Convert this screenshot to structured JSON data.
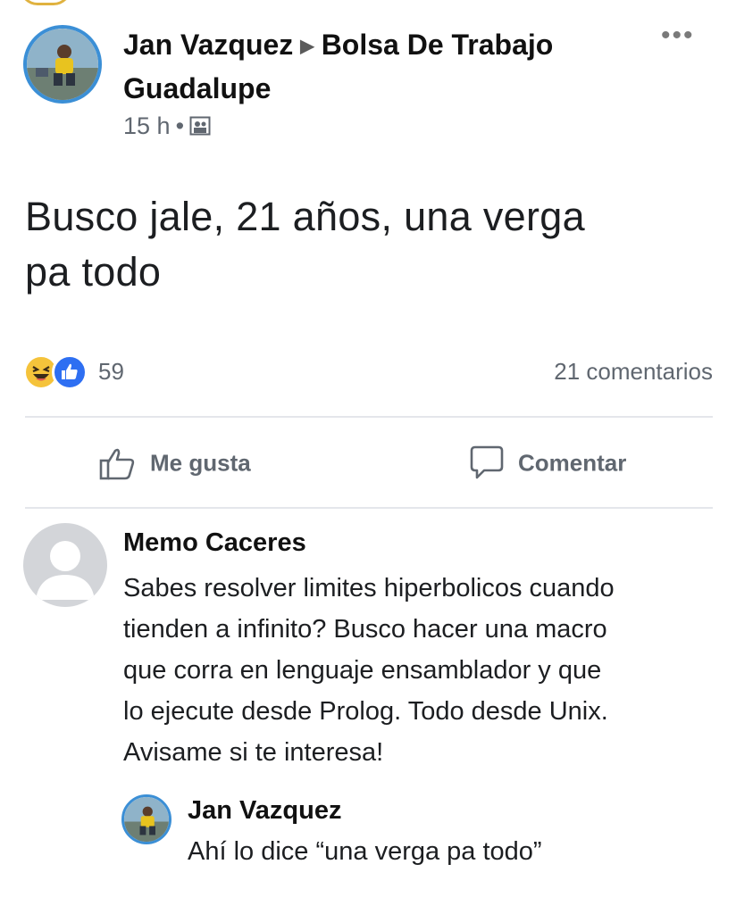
{
  "post": {
    "author": "Jan Vazquez",
    "group_line1": "Bolsa De Trabajo",
    "group_line2": "Guadalupe",
    "time": "15 h",
    "text_line1": "Busco jale, 21 años, una verga",
    "text_line2": "pa todo",
    "reaction_count": "59",
    "comment_count": "21 comentarios"
  },
  "actions": {
    "like_label": "Me gusta",
    "comment_label": "Comentar"
  },
  "comments": [
    {
      "author": "Memo Caceres",
      "lines": [
        "Sabes resolver limites hiperbolicos cuando",
        "tienden a infinito? Busco hacer una macro",
        "que corra en lenguaje ensamblador y que",
        "lo ejecute desde Prolog. Todo desde Unix.",
        "Avisame si te interesa!"
      ]
    }
  ],
  "reply": {
    "author": "Jan Vazquez",
    "text": "Ahí lo dice “una verga pa todo”"
  },
  "colors": {
    "accent": "#2e6ff2",
    "avatar_ring": "#3b8fd6",
    "haha": "#f5c33b",
    "muted_text": "#606770"
  },
  "icons": [
    "more-options-icon",
    "group-privacy-icon",
    "haha-reaction-icon",
    "like-reaction-icon",
    "thumbs-up-icon",
    "comment-bubble-icon",
    "default-avatar-icon"
  ]
}
